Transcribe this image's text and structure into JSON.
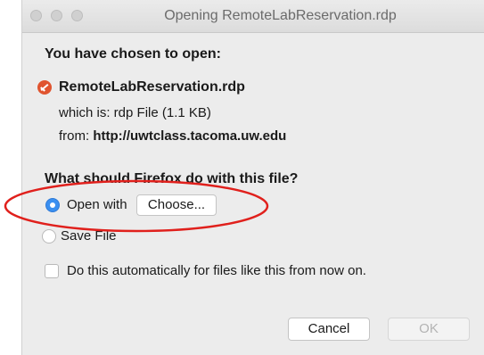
{
  "window": {
    "title": "Opening RemoteLabReservation.rdp"
  },
  "dialog": {
    "heading": "You have chosen to open:",
    "file_name": "RemoteLabReservation.rdp",
    "which_is": "which is: rdp File (1.1 KB)",
    "from_label": "from:",
    "from_url": "http://uwtclass.tacoma.uw.edu",
    "question": "What should Firefox do with this file?",
    "open_with_label": "Open with",
    "choose_label": "Choose...",
    "save_file_label": "Save File",
    "auto_label": "Do this automatically for files like this from now on.",
    "cancel_label": "Cancel",
    "ok_label": "OK",
    "selected_option": "open_with",
    "auto_checked": false,
    "ok_enabled": false
  },
  "icons": {
    "file_icon": "rdp-file-icon",
    "file_icon_color": "#e0542f"
  },
  "colors": {
    "accent": "#3a8ff0",
    "annotation": "#e0201c"
  }
}
